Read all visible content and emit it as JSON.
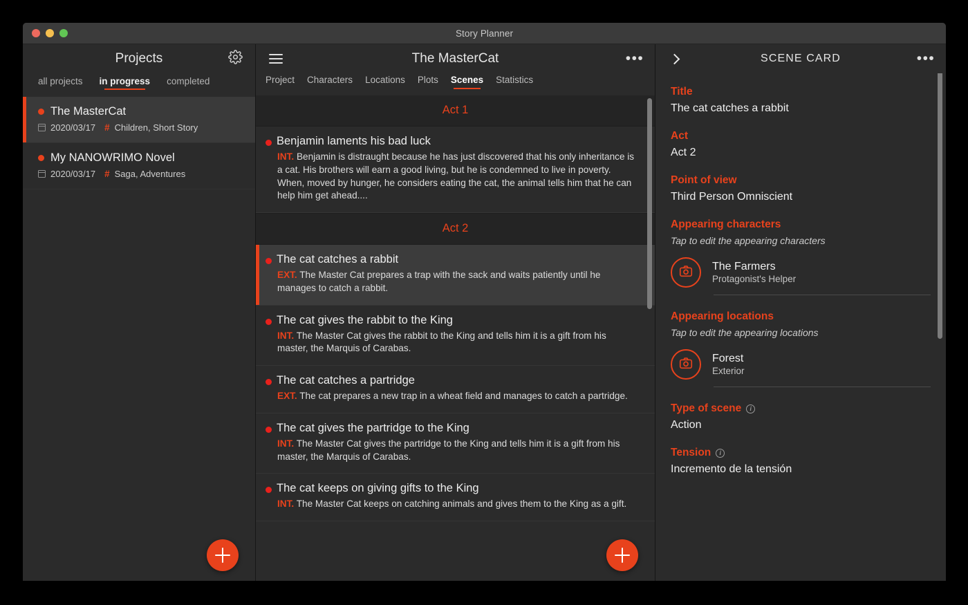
{
  "window": {
    "title": "Story Planner",
    "traffic_lights": [
      "close-red",
      "minimize-yellow",
      "maximize-green"
    ]
  },
  "accent_color": "#e8421c",
  "sidebar": {
    "header_title": "Projects",
    "settings_icon": "gear-icon",
    "filters": [
      {
        "label": "all projects",
        "active": false
      },
      {
        "label": "in progress",
        "active": true
      },
      {
        "label": "completed",
        "active": false
      }
    ],
    "projects": [
      {
        "title": "The MasterCat",
        "date": "2020/03/17",
        "tags": "Children, Short Story",
        "selected": true
      },
      {
        "title": "My NANOWRIMO Novel",
        "date": "2020/03/17",
        "tags": "Saga, Adventures",
        "selected": false
      }
    ],
    "add_button": "add-project-button"
  },
  "center": {
    "menu_icon": "hamburger-menu-icon",
    "header_title": "The MasterCat",
    "overflow_icon": "more-options-icon",
    "tabs": [
      {
        "label": "Project",
        "active": false
      },
      {
        "label": "Characters",
        "active": false
      },
      {
        "label": "Locations",
        "active": false
      },
      {
        "label": "Plots",
        "active": false
      },
      {
        "label": "Scenes",
        "active": true
      },
      {
        "label": "Statistics",
        "active": false
      }
    ],
    "groups": [
      {
        "act": "Act 1",
        "scenes": [
          {
            "title": "Benjamin laments his bad luck",
            "intext": "INT.",
            "description": "Benjamin is distraught because he has just discovered that his only inheritance is a cat. His brothers will earn a good living, but he is condemned to live in poverty. When, moved by hunger, he considers eating the cat, the animal tells him that he can help him get ahead....",
            "selected": false
          }
        ]
      },
      {
        "act": "Act 2",
        "scenes": [
          {
            "title": "The cat catches a rabbit",
            "intext": "EXT.",
            "description": "The Master Cat prepares a trap with the sack and waits patiently until he manages to catch a rabbit.",
            "selected": true
          },
          {
            "title": "The cat gives the rabbit to the King",
            "intext": "INT.",
            "description": "The Master Cat gives the rabbit to the King and tells him it is a gift from his master, the Marquis of Carabas.",
            "selected": false
          },
          {
            "title": "The cat catches a partridge",
            "intext": "EXT.",
            "description": "The cat prepares a new trap in a wheat field and manages to catch a partridge.",
            "selected": false
          },
          {
            "title": "The cat gives the partridge to the King",
            "intext": "INT.",
            "description": "The Master Cat gives the partridge to the King and tells him it is a gift from his master, the Marquis of Carabas.",
            "selected": false
          },
          {
            "title": "The cat keeps on giving gifts to the King",
            "intext": "INT.",
            "description": "The Master Cat keeps on catching animals and gives them to the King as a gift.",
            "selected": false
          }
        ]
      }
    ],
    "add_button": "add-scene-button"
  },
  "scene_card": {
    "back_icon": "chevron-right-icon",
    "header_title": "SCENE CARD",
    "overflow_icon": "more-options-icon",
    "fields": {
      "title_label": "Title",
      "title_value": "The cat catches a rabbit",
      "act_label": "Act",
      "act_value": "Act 2",
      "pov_label": "Point of view",
      "pov_value": "Third Person Omniscient",
      "characters_label": "Appearing characters",
      "characters_hint": "Tap to edit the appearing characters",
      "locations_label": "Appearing locations",
      "locations_hint": "Tap to edit the appearing locations",
      "type_label": "Type of scene",
      "type_value": "Action",
      "tension_label": "Tension",
      "tension_value": "Incremento de la tensión"
    },
    "characters": [
      {
        "name": "The Farmers",
        "role": "Protagonist's Helper",
        "avatar": "camera-icon"
      }
    ],
    "locations": [
      {
        "name": "Forest",
        "role": "Exterior",
        "avatar": "camera-icon"
      }
    ]
  }
}
